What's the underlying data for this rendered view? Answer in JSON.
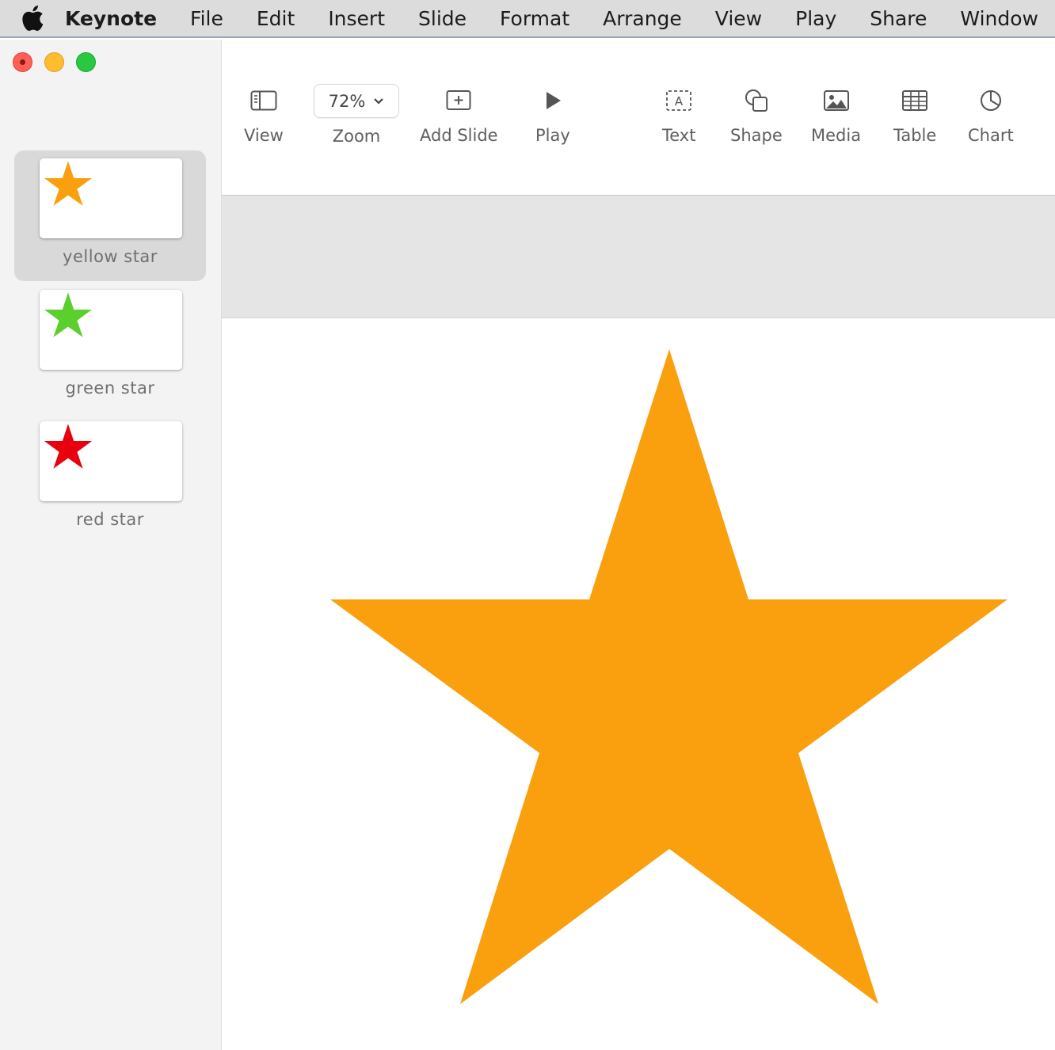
{
  "menubar": {
    "app_name": "Keynote",
    "items": [
      "File",
      "Edit",
      "Insert",
      "Slide",
      "Format",
      "Arrange",
      "View",
      "Play",
      "Share",
      "Window"
    ]
  },
  "toolbar": {
    "view_label": "View",
    "zoom_value": "72%",
    "zoom_label": "Zoom",
    "add_slide_label": "Add Slide",
    "play_label": "Play",
    "text_label": "Text",
    "shape_label": "Shape",
    "media_label": "Media",
    "table_label": "Table",
    "chart_label": "Chart"
  },
  "slides": [
    {
      "label": "yellow star",
      "color": "#fa9f0e",
      "selected": true
    },
    {
      "label": "green star",
      "color": "#5bd02d",
      "selected": false
    },
    {
      "label": "red star",
      "color": "#e8000f",
      "selected": false
    }
  ],
  "canvas": {
    "shape": "star-icon",
    "color": "#fa9f0e"
  },
  "colors": {
    "close": "#fe5f57",
    "minimize": "#febc2e",
    "zoom": "#28c840"
  }
}
